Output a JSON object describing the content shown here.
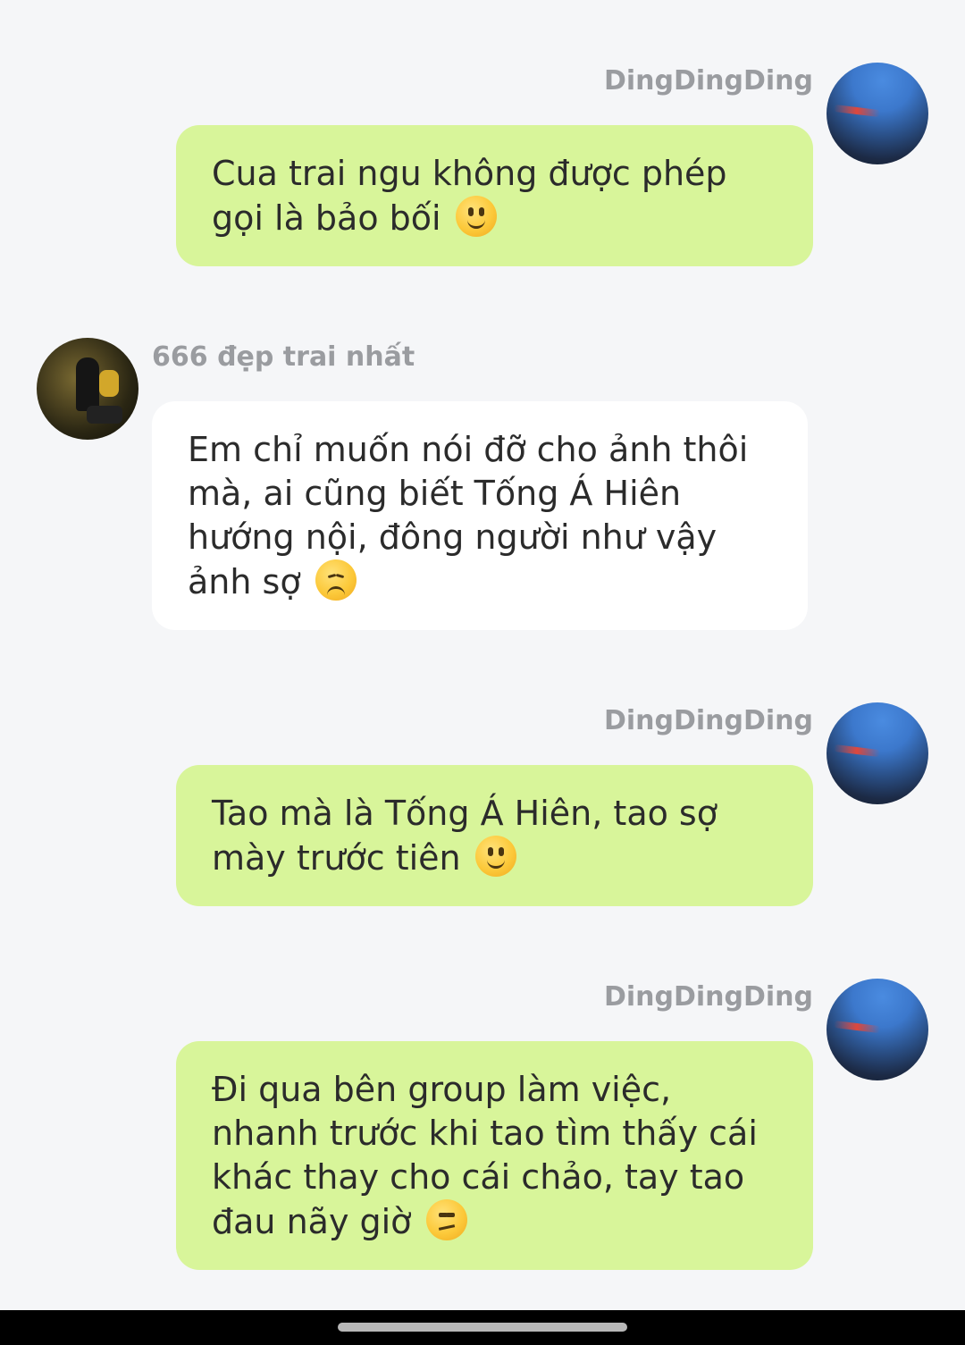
{
  "messages": [
    {
      "sender": "DingDingDing",
      "text": "Cua trai ngu không được phép gọi là bảo bối",
      "emoji": "slightly-smiling-face-icon"
    },
    {
      "sender": "666 đẹp trai nhất",
      "text": "Em chỉ muốn nói đỡ cho ảnh thôi mà, ai cũng biết Tống Á Hiên hướng nội, đông người như vậy ảnh sợ",
      "emoji": "disappointed-face-icon"
    },
    {
      "sender": "DingDingDing",
      "text": "Tao mà là Tống Á Hiên, tao sợ mày trước tiên",
      "emoji": "slightly-smiling-face-icon"
    },
    {
      "sender": "DingDingDing",
      "text": "Đi qua bên group làm việc, nhanh trước khi tao tìm thấy cái khác thay cho cái chảo, tay tao đau nãy giờ",
      "emoji": "unamused-face-icon"
    }
  ],
  "colors": {
    "background": "#f5f6f8",
    "outgoing_bubble": "#d8f59a",
    "incoming_bubble": "#ffffff",
    "sender_name": "#9a9ca0"
  }
}
